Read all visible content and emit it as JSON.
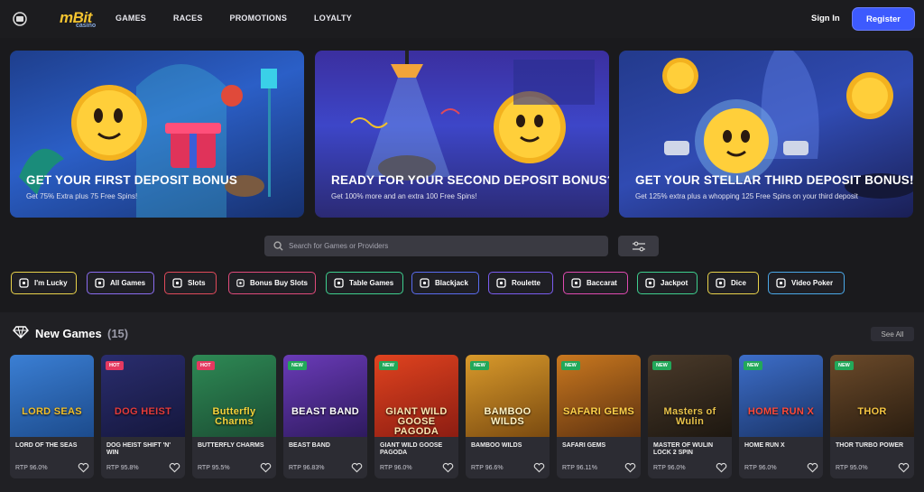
{
  "header": {
    "logo": "mBit",
    "logo_sub": "casino",
    "nav": [
      "GAMES",
      "RACES",
      "PROMOTIONS",
      "LOYALTY"
    ],
    "sign_in": "Sign In",
    "register": "Register"
  },
  "banners": [
    {
      "title": "GET YOUR FIRST DEPOSIT BONUS",
      "subtitle": "Get 75% Extra plus 75 Free Spins!"
    },
    {
      "title": "READY FOR YOUR SECOND DEPOSIT BONUS?",
      "subtitle": "Get 100% more and an extra 100 Free Spins!"
    },
    {
      "title": "GET YOUR STELLAR THIRD DEPOSIT BONUS!",
      "subtitle": "Get 125% extra plus a whopping 125 Free Spins on your third deposit"
    }
  ],
  "search": {
    "placeholder": "Search for Games or Providers"
  },
  "categories": [
    {
      "label": "I'm Lucky",
      "icon": "clover-icon",
      "color": "#e8d24a"
    },
    {
      "label": "All Games",
      "icon": "cards-icon",
      "color": "#8a6cf0"
    },
    {
      "label": "Slots",
      "icon": "slot-777-icon",
      "color": "#e04a5a"
    },
    {
      "label": "Bonus Buy Slots",
      "icon": "gift-icon",
      "color": "#e04a7a"
    },
    {
      "label": "Table Games",
      "icon": "table-icon",
      "color": "#3ecf8e"
    },
    {
      "label": "Blackjack",
      "icon": "playing-card-icon",
      "color": "#5a6cf0"
    },
    {
      "label": "Roulette",
      "icon": "roulette-icon",
      "color": "#7a5cf0"
    },
    {
      "label": "Baccarat",
      "icon": "baccarat-icon",
      "color": "#e04ab0"
    },
    {
      "label": "Jackpot",
      "icon": "jackpot-icon",
      "color": "#3ecf8e"
    },
    {
      "label": "Dice",
      "icon": "dice-icon",
      "color": "#e8d24a"
    },
    {
      "label": "Video Poker",
      "icon": "poker-chip-icon",
      "color": "#4aa8e8"
    }
  ],
  "new_games": {
    "title": "New Games",
    "count": "(15)",
    "see_all": "See All",
    "games": [
      {
        "title": "LORD OF THE SEAS",
        "rtp": "RTP 96.0%",
        "badge": "",
        "art_text": "LORD SEAS",
        "bg1": "#3b7fd4",
        "bg2": "#1c4b8c",
        "fg": "#f2c02a"
      },
      {
        "title": "DOG HEIST SHIFT 'N' WIN",
        "rtp": "RTP 95.8%",
        "badge": "HOT",
        "art_text": "DOG HEIST",
        "bg1": "#2a2d6e",
        "bg2": "#15173d",
        "fg": "#e43b3b"
      },
      {
        "title": "BUTTERFLY CHARMS",
        "rtp": "RTP 95.5%",
        "badge": "HOT",
        "art_text": "Butterfly Charms",
        "bg1": "#2e8a55",
        "bg2": "#1b4d33",
        "fg": "#f5d33b"
      },
      {
        "title": "BEAST BAND",
        "rtp": "RTP 96.83%",
        "badge": "NEW",
        "art_text": "BEAST BAND",
        "bg1": "#6a3bb8",
        "bg2": "#2e1a5e",
        "fg": "#ffffff"
      },
      {
        "title": "GIANT WILD GOOSE PAGODA",
        "rtp": "RTP 96.0%",
        "badge": "NEW",
        "art_text": "GIANT WILD GOOSE PAGODA",
        "bg1": "#e0431f",
        "bg2": "#8c1d12",
        "fg": "#fbe6b0"
      },
      {
        "title": "BAMBOO WILDS",
        "rtp": "RTP 96.6%",
        "badge": "NEW",
        "art_text": "BAMBOO WILDS",
        "bg1": "#d99a2b",
        "bg2": "#7a4a10",
        "fg": "#fff3c4"
      },
      {
        "title": "SAFARI GEMS",
        "rtp": "RTP 96.11%",
        "badge": "NEW",
        "art_text": "SAFARI GEMS",
        "bg1": "#c9781f",
        "bg2": "#5e3210",
        "fg": "#ffd24a"
      },
      {
        "title": "MASTER OF WULIN LOCK 2 SPIN",
        "rtp": "RTP 96.0%",
        "badge": "NEW",
        "art_text": "Masters of Wulin",
        "bg1": "#4a3a2a",
        "bg2": "#1d1710",
        "fg": "#e8c24a"
      },
      {
        "title": "HOME RUN X",
        "rtp": "RTP 96.0%",
        "badge": "NEW",
        "art_text": "HOME RUN X",
        "bg1": "#3d6ec9",
        "bg2": "#1a3468",
        "fg": "#ff4a3a"
      },
      {
        "title": "THOR TURBO POWER",
        "rtp": "RTP 95.0%",
        "badge": "NEW",
        "art_text": "THOR",
        "bg1": "#6b4a2a",
        "bg2": "#2a1d10",
        "fg": "#f5c542"
      }
    ]
  }
}
